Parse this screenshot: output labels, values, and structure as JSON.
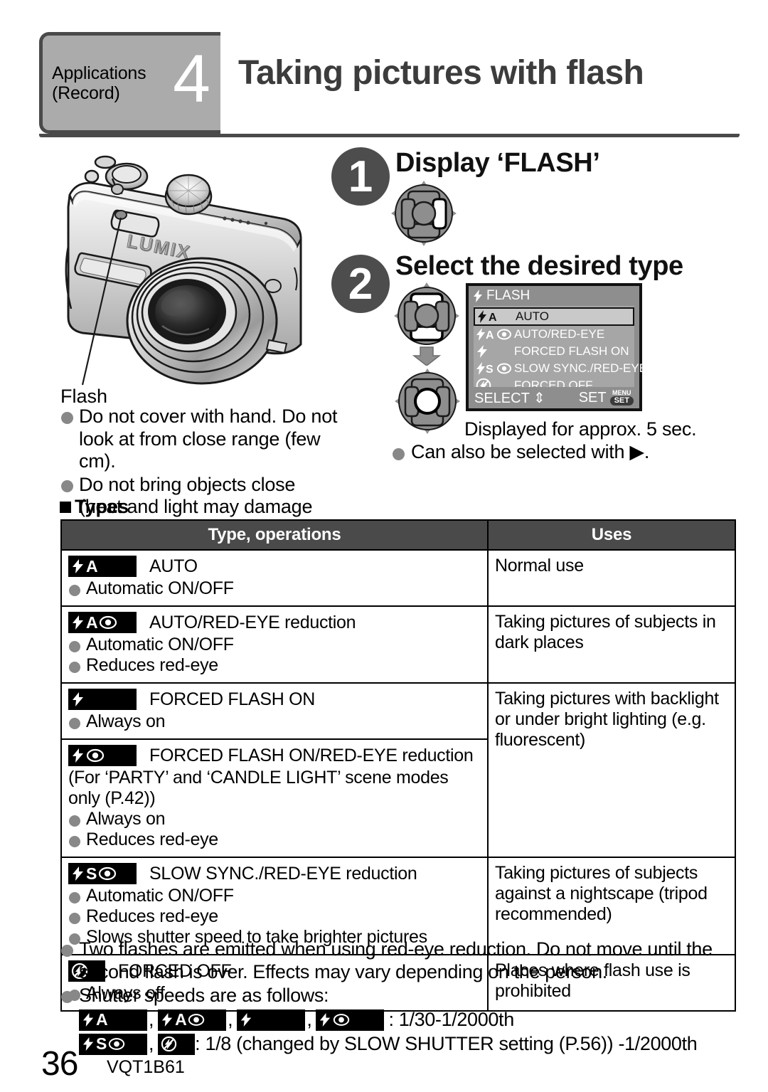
{
  "header": {
    "chapter_label": "Applications\n(Record)",
    "chapter_number": "4",
    "title": "Taking pictures with flash"
  },
  "camera": {
    "brand_text": "LUMIX",
    "callout_label": "Flash",
    "notes": [
      "Do not cover with hand. Do not look at from close range (few cm).",
      "Do not bring objects close (heat and light may damage object)."
    ]
  },
  "steps": [
    {
      "number": "1",
      "title": "Display ‘FLASH’"
    },
    {
      "number": "2",
      "title": "Select the desired type"
    }
  ],
  "lcd": {
    "title": "FLASH",
    "rows": [
      {
        "icon": "flash-auto-icon",
        "label": "AUTO",
        "selected": true
      },
      {
        "icon": "flash-auto-redeye-icon",
        "label": "AUTO/RED-EYE",
        "selected": false
      },
      {
        "icon": "flash-forced-on-icon",
        "label": "FORCED FLASH ON",
        "selected": false
      },
      {
        "icon": "flash-slow-sync-redeye-icon",
        "label": "SLOW SYNC./RED-EYE",
        "selected": false
      },
      {
        "icon": "flash-forced-off-icon",
        "label": "FORCED OFF",
        "selected": false
      }
    ],
    "footer_select": "SELECT",
    "footer_set": "SET",
    "menu_badge_top": "MENU",
    "menu_badge_bottom": "SET"
  },
  "lcd_caption": "Displayed for approx. 5 sec.",
  "lcd_note": "Can also be selected with ▶.",
  "types_section": {
    "heading": "Types",
    "columns": [
      "Type, operations",
      "Uses"
    ],
    "rows": [
      {
        "icon": "flash-auto-icon",
        "name": "AUTO",
        "detail_lines": [],
        "bullets": [
          "Automatic ON/OFF"
        ],
        "uses": "Normal use"
      },
      {
        "icon": "flash-auto-redeye-icon",
        "name": "AUTO/RED-EYE reduction",
        "detail_lines": [],
        "bullets": [
          "Automatic ON/OFF",
          "Reduces red-eye"
        ],
        "uses": "Taking pictures of subjects in dark places"
      },
      {
        "icon": "flash-forced-on-icon",
        "name": "FORCED FLASH ON",
        "detail_lines": [],
        "bullets": [
          "Always on"
        ],
        "uses": "Taking pictures with backlight or under bright lighting (e.g. fluorescent)",
        "uses_rowspan": 2
      },
      {
        "icon": "flash-forced-on-redeye-icon",
        "name": "FORCED FLASH ON/RED-EYE reduction",
        "detail_lines": [
          "(For ‘PARTY’ and ‘CANDLE LIGHT’ scene modes only (P.42))"
        ],
        "bullets": [
          "Always on",
          "Reduces red-eye"
        ],
        "uses": null
      },
      {
        "icon": "flash-slow-sync-redeye-icon",
        "name": "SLOW SYNC./RED-EYE reduction",
        "detail_lines": [],
        "bullets": [
          "Automatic ON/OFF",
          "Reduces red-eye",
          "Slows shutter speed to take brighter pictures"
        ],
        "uses": "Taking pictures of subjects against a nightscape (tripod recommended)"
      },
      {
        "icon": "flash-forced-off-icon",
        "name": "FORCED OFF",
        "detail_lines": [],
        "bullets": [
          "Always off"
        ],
        "uses": "Places where flash use is prohibited"
      }
    ]
  },
  "footer_notes": {
    "note1": "Two flashes are emitted when using red-eye reduction. Do not move until the second flash is over. Effects may vary depending on the person.",
    "note2": "Shutter speeds are as follows:",
    "speed_row1_value": ": 1/30-1/2000th",
    "speed_row2_value": ": 1/8 (changed by SLOW SHUTTER setting (P.56)) -1/2000th",
    "comma": ","
  },
  "page": {
    "number": "36",
    "code": "VQT1B61"
  },
  "colors": {
    "header_chip": "#ababab",
    "header_border": "#4a4a4a",
    "step_badge": "#4d4d4d",
    "table_header": "#4a4a4a",
    "bullet": "#888888",
    "lcd_bg": "#8e8e8e",
    "lcd_list": "#a6a6a6",
    "lcd_selected": "#c9c9c9",
    "icon_chip": "#000000"
  }
}
